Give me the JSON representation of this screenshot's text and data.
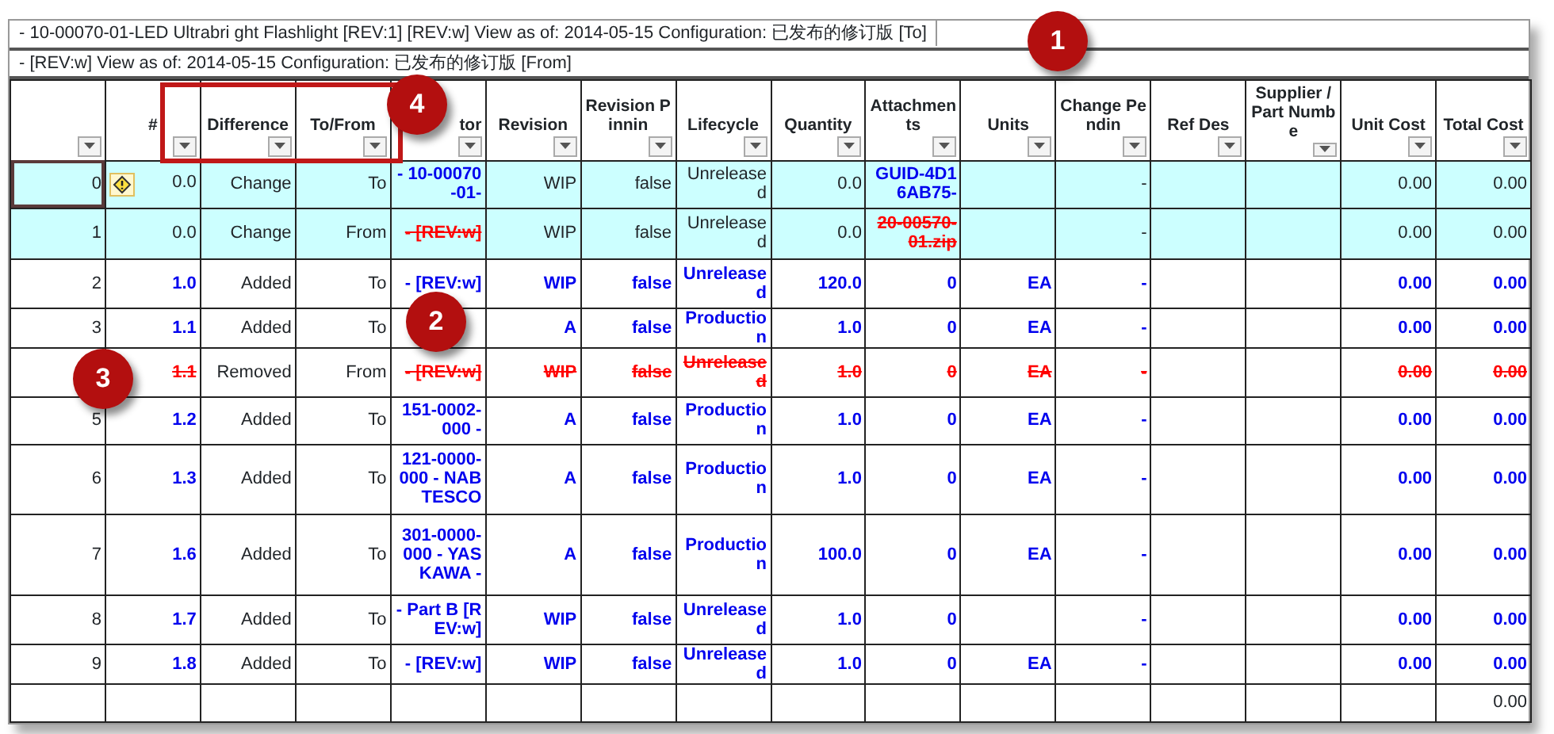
{
  "titles": [
    "- 10-00070-01-LED Ultrabri ght Flashlight [REV:1] [REV:w] View as of: 2014-05-15 Configuration: 已发布的修订版 [To]",
    "-  [REV:w] View as of: 2014-05-15 Configuration: 已发布的修订版 [From]"
  ],
  "columns": [
    "#",
    "Difference",
    "To/From",
    "tor",
    "Revision",
    "Revision Pinnin",
    "Lifecycle",
    "Quantity",
    "Attachments",
    "Units",
    "Change Pendin",
    "Ref Des",
    "Supplier / Part Numbe",
    "Unit Cost",
    "Total Cost"
  ],
  "rows": [
    {
      "row_number": "0",
      "selected": true,
      "highlighted": true,
      "warning": true,
      "cells": [
        "0.0",
        "Change",
        "To",
        {
          "text": "- 10-00070-01-",
          "kind": "added"
        },
        "WIP",
        "false",
        "Unreleased",
        "0.0",
        {
          "text": "GUID-4D16AB75-",
          "kind": "added"
        },
        null,
        "-",
        null,
        null,
        "0.00",
        "0.00"
      ]
    },
    {
      "row_number": "1",
      "selected": false,
      "highlighted": true,
      "warning": false,
      "cells": [
        "0.0",
        "Change",
        "From",
        {
          "text": "- [REV:w]",
          "kind": "removed"
        },
        "WIP",
        "false",
        "Unreleased",
        "0.0",
        {
          "text": "20-00570-01.zip",
          "kind": "removed"
        },
        null,
        "-",
        null,
        null,
        "0.00",
        "0.00"
      ]
    },
    {
      "row_number": "2",
      "selected": false,
      "highlighted": false,
      "warning": false,
      "cells": [
        {
          "text": "1.0",
          "kind": "added"
        },
        "Added",
        "To",
        {
          "text": "- [REV:w]",
          "kind": "added"
        },
        {
          "text": "WIP",
          "kind": "added"
        },
        {
          "text": "false",
          "kind": "added"
        },
        {
          "text": "Unreleased",
          "kind": "added"
        },
        {
          "text": "120.0",
          "kind": "added"
        },
        {
          "text": "0",
          "kind": "added"
        },
        {
          "text": "EA",
          "kind": "added"
        },
        {
          "text": "-",
          "kind": "added"
        },
        null,
        null,
        {
          "text": "0.00",
          "kind": "added"
        },
        {
          "text": "0.00",
          "kind": "added"
        }
      ]
    },
    {
      "row_number": "3",
      "selected": false,
      "highlighted": false,
      "warning": false,
      "cells": [
        {
          "text": "1.1",
          "kind": "added"
        },
        "Added",
        "To",
        null,
        {
          "text": "A",
          "kind": "added"
        },
        {
          "text": "false",
          "kind": "added"
        },
        {
          "text": "Production",
          "kind": "added"
        },
        {
          "text": "1.0",
          "kind": "added"
        },
        {
          "text": "0",
          "kind": "added"
        },
        {
          "text": "EA",
          "kind": "added"
        },
        {
          "text": "-",
          "kind": "added"
        },
        null,
        null,
        {
          "text": "0.00",
          "kind": "added"
        },
        {
          "text": "0.00",
          "kind": "added"
        }
      ]
    },
    {
      "selected": false,
      "highlighted": false,
      "warning": false,
      "cells": [
        {
          "text": "1.1",
          "kind": "removed"
        },
        "Removed",
        "From",
        {
          "text": "- [REV:w]",
          "kind": "removed"
        },
        {
          "text": "WIP",
          "kind": "removed"
        },
        {
          "text": "false",
          "kind": "removed"
        },
        {
          "text": "Unreleased",
          "kind": "removed"
        },
        {
          "text": "1.0",
          "kind": "removed"
        },
        {
          "text": "0",
          "kind": "removed"
        },
        {
          "text": "EA",
          "kind": "removed"
        },
        {
          "text": "-",
          "kind": "removed"
        },
        null,
        null,
        {
          "text": "0.00",
          "kind": "removed"
        },
        {
          "text": "0.00",
          "kind": "removed"
        }
      ]
    },
    {
      "row_number": "5",
      "selected": false,
      "highlighted": false,
      "warning": false,
      "cells": [
        {
          "text": "1.2",
          "kind": "added"
        },
        "Added",
        "To",
        {
          "text": "151-0002-000 -",
          "kind": "added"
        },
        {
          "text": "A",
          "kind": "added"
        },
        {
          "text": "false",
          "kind": "added"
        },
        {
          "text": "Production",
          "kind": "added"
        },
        {
          "text": "1.0",
          "kind": "added"
        },
        {
          "text": "0",
          "kind": "added"
        },
        {
          "text": "EA",
          "kind": "added"
        },
        {
          "text": "-",
          "kind": "added"
        },
        null,
        null,
        {
          "text": "0.00",
          "kind": "added"
        },
        {
          "text": "0.00",
          "kind": "added"
        }
      ]
    },
    {
      "row_number": "6",
      "selected": false,
      "highlighted": false,
      "warning": false,
      "cells": [
        {
          "text": "1.3",
          "kind": "added"
        },
        "Added",
        "To",
        {
          "text": "121-0000-000 - NABTESCO",
          "kind": "added"
        },
        {
          "text": "A",
          "kind": "added"
        },
        {
          "text": "false",
          "kind": "added"
        },
        {
          "text": "Production",
          "kind": "added"
        },
        {
          "text": "1.0",
          "kind": "added"
        },
        {
          "text": "0",
          "kind": "added"
        },
        {
          "text": "EA",
          "kind": "added"
        },
        {
          "text": "-",
          "kind": "added"
        },
        null,
        null,
        {
          "text": "0.00",
          "kind": "added"
        },
        {
          "text": "0.00",
          "kind": "added"
        }
      ]
    },
    {
      "row_number": "7",
      "selected": false,
      "highlighted": false,
      "warning": false,
      "cells": [
        {
          "text": "1.6",
          "kind": "added"
        },
        "Added",
        "To",
        {
          "text": "301-0000-000 - YASKAWA -",
          "kind": "added"
        },
        {
          "text": "A",
          "kind": "added"
        },
        {
          "text": "false",
          "kind": "added"
        },
        {
          "text": "Production",
          "kind": "added"
        },
        {
          "text": "100.0",
          "kind": "added"
        },
        {
          "text": "0",
          "kind": "added"
        },
        {
          "text": "EA",
          "kind": "added"
        },
        {
          "text": "-",
          "kind": "added"
        },
        null,
        null,
        {
          "text": "0.00",
          "kind": "added"
        },
        {
          "text": "0.00",
          "kind": "added"
        }
      ]
    },
    {
      "row_number": "8",
      "selected": false,
      "highlighted": false,
      "warning": false,
      "cells": [
        {
          "text": "1.7",
          "kind": "added"
        },
        "Added",
        "To",
        {
          "text": "- Part B [REV:w]",
          "kind": "added"
        },
        {
          "text": "WIP",
          "kind": "added"
        },
        {
          "text": "false",
          "kind": "added"
        },
        {
          "text": "Unreleased",
          "kind": "added"
        },
        {
          "text": "1.0",
          "kind": "added"
        },
        {
          "text": "0",
          "kind": "added"
        },
        null,
        {
          "text": "-",
          "kind": "added"
        },
        null,
        null,
        {
          "text": "0.00",
          "kind": "added"
        },
        {
          "text": "0.00",
          "kind": "added"
        }
      ]
    },
    {
      "row_number": "9",
      "selected": false,
      "highlighted": false,
      "warning": false,
      "cells": [
        {
          "text": "1.8",
          "kind": "added"
        },
        "Added",
        "To",
        {
          "text": "- [REV:w]",
          "kind": "added"
        },
        {
          "text": "WIP",
          "kind": "added"
        },
        {
          "text": "false",
          "kind": "added"
        },
        {
          "text": "Unreleased",
          "kind": "added"
        },
        {
          "text": "1.0",
          "kind": "added"
        },
        {
          "text": "0",
          "kind": "added"
        },
        {
          "text": "EA",
          "kind": "added"
        },
        {
          "text": "-",
          "kind": "added"
        },
        null,
        null,
        {
          "text": "0.00",
          "kind": "added"
        },
        {
          "text": "0.00",
          "kind": "added"
        }
      ]
    },
    {
      "selected": false,
      "highlighted": false,
      "warning": false,
      "cells": [
        null,
        null,
        null,
        null,
        null,
        null,
        null,
        null,
        null,
        null,
        null,
        null,
        null,
        null,
        "0.00"
      ]
    }
  ],
  "callouts": [
    {
      "label": "1"
    },
    {
      "label": "2"
    },
    {
      "label": "3"
    },
    {
      "label": "4"
    }
  ]
}
